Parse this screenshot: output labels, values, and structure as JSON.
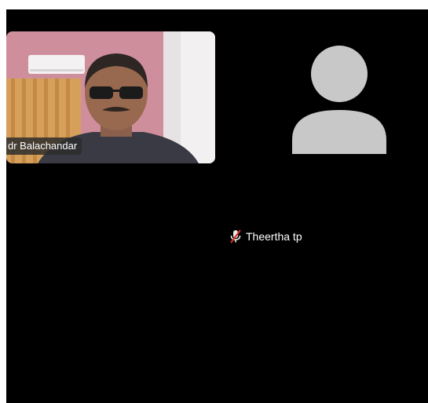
{
  "video_tile": {
    "name": "dr Balachandar"
  },
  "participant": {
    "name": "Theertha tp",
    "mic_status": "muted",
    "icon": "mic-off-icon",
    "avatar_icon": "person-avatar-icon"
  },
  "colors": {
    "stage_background": "#000000",
    "avatar_fill": "#c8c8c8",
    "mic_off_red": "#d93025",
    "name_text": "#ffffff"
  }
}
